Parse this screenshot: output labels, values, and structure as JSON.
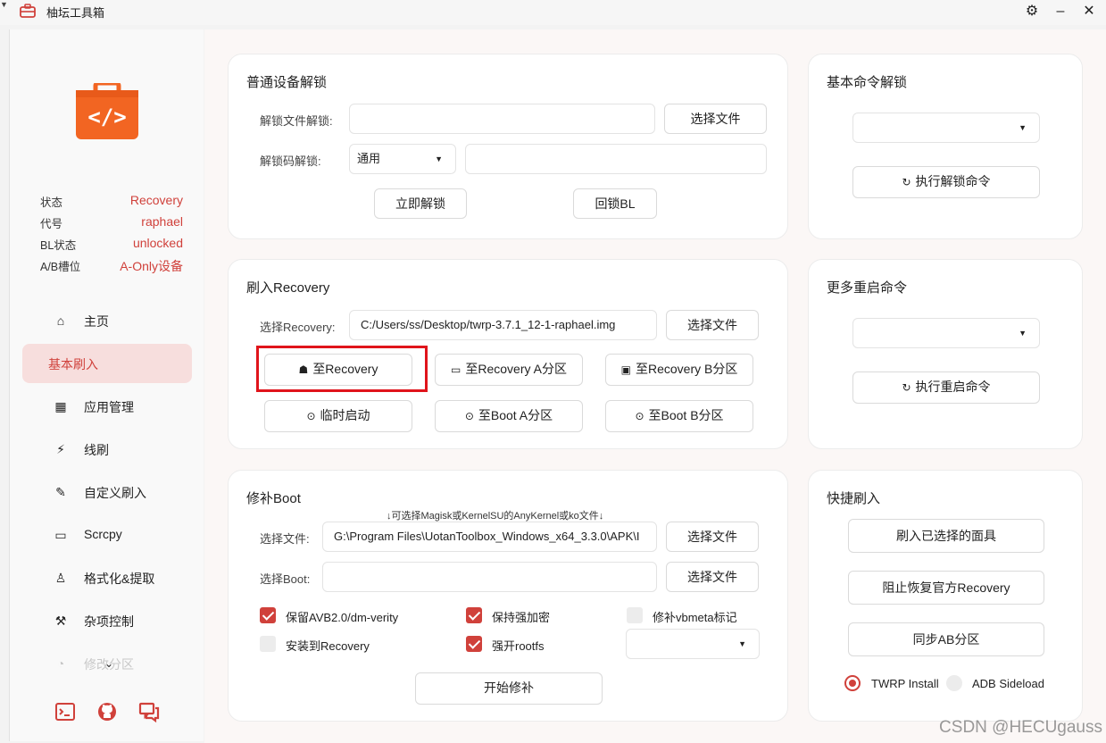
{
  "window": {
    "title": "柚坛工具箱",
    "controls": [
      "gear-icon",
      "minimize-icon",
      "close-icon"
    ]
  },
  "device_info": [
    {
      "key": "状态",
      "value": "Recovery"
    },
    {
      "key": "代号",
      "value": "raphael"
    },
    {
      "key": "BL状态",
      "value": "unlocked"
    },
    {
      "key": "A/B槽位",
      "value": "A-Only设备"
    }
  ],
  "nav": [
    {
      "label": "主页",
      "icon": "home-icon"
    },
    {
      "label": "基本刷入",
      "icon": "",
      "active": true
    },
    {
      "label": "应用管理",
      "icon": "grid-icon"
    },
    {
      "label": "线刷",
      "icon": "flash-icon"
    },
    {
      "label": "自定义刷入",
      "icon": "wand-icon"
    },
    {
      "label": "Scrcpy",
      "icon": "screen-icon"
    },
    {
      "label": "格式化&提取",
      "icon": "user-box-icon"
    },
    {
      "label": "杂项控制",
      "icon": "tools-icon"
    },
    {
      "label": "修改分区",
      "icon": "pie-icon"
    }
  ],
  "unlock": {
    "title": "普通设备解锁",
    "file_label": "解锁文件解锁:",
    "file_value": "",
    "choose_file": "选择文件",
    "code_label": "解锁码解锁:",
    "code_type": "通用",
    "code_value": "",
    "unlock_now": "立即解锁",
    "relock": "回锁BL"
  },
  "basic_cmd": {
    "title": "基本命令解锁",
    "select_value": "",
    "run": "执行解锁命令"
  },
  "recovery": {
    "title": "刷入Recovery",
    "select_label": "选择Recovery:",
    "path": "C:/Users/ss/Desktop/twrp-3.7.1_12-1-raphael.img",
    "choose_file": "选择文件",
    "btn_recovery": "至Recovery",
    "btn_recovery_a": "至Recovery A分区",
    "btn_recovery_b": "至Recovery B分区",
    "btn_temp_boot": "临时启动",
    "btn_boot_a": "至Boot A分区",
    "btn_boot_b": "至Boot B分区"
  },
  "reboot": {
    "title": "更多重启命令",
    "select_value": "",
    "run": "执行重启命令"
  },
  "patch": {
    "title": "修补Boot",
    "hint": "↓可选择Magisk或KernelSU的AnyKernel或ko文件↓",
    "file_label": "选择文件:",
    "file_value": "G:\\Program Files\\UotanToolbox_Windows_x64_3.3.0\\APK\\I",
    "choose_file": "选择文件",
    "boot_label": "选择Boot:",
    "boot_value": "",
    "choose_boot": "选择文件",
    "options": [
      {
        "label": "保留AVB2.0/dm-verity",
        "checked": true
      },
      {
        "label": "保持强加密",
        "checked": true
      },
      {
        "label": "修补vbmeta标记",
        "checked": false
      },
      {
        "label": "安装到Recovery",
        "checked": false
      },
      {
        "label": "强开rootfs",
        "checked": true
      }
    ],
    "extra_select": "",
    "start": "开始修补"
  },
  "quick": {
    "title": "快捷刷入",
    "btn_mask": "刷入已选择的面具",
    "btn_block": "阻止恢复官方Recovery",
    "btn_sync": "同步AB分区",
    "radio_twrp": "TWRP Install",
    "radio_twrp_on": true,
    "radio_adb": "ADB Sideload",
    "radio_adb_on": false
  },
  "watermark": "CSDN @HECUgauss",
  "colors": {
    "accent": "#d0413b",
    "highlight_box": "#e0141b",
    "logo": "#f26522"
  }
}
